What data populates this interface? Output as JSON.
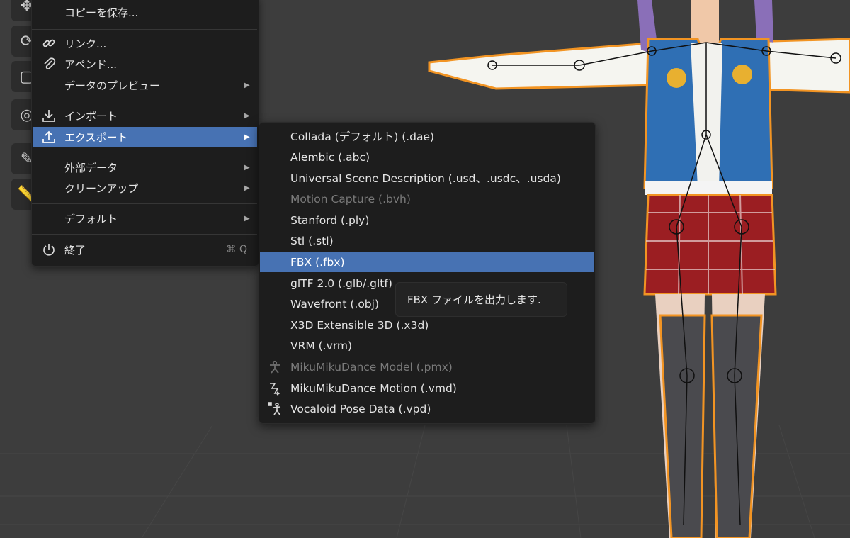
{
  "file_menu": {
    "items": [
      {
        "label": "コピーを保存...",
        "arrow": "",
        "shortcut": ""
      },
      {
        "label": "リンク...",
        "arrow": "",
        "shortcut": ""
      },
      {
        "label": "アペンド...",
        "arrow": "",
        "shortcut": ""
      },
      {
        "label": "データのプレビュー",
        "arrow": "▶",
        "shortcut": ""
      },
      {
        "label": "インポート",
        "arrow": "▶",
        "shortcut": ""
      },
      {
        "label": "エクスポート",
        "arrow": "▶",
        "shortcut": ""
      },
      {
        "label": "外部データ",
        "arrow": "▶",
        "shortcut": ""
      },
      {
        "label": "クリーンアップ",
        "arrow": "▶",
        "shortcut": ""
      },
      {
        "label": "デフォルト",
        "arrow": "▶",
        "shortcut": ""
      },
      {
        "label": "終了",
        "arrow": "",
        "shortcut": "⌘ Q"
      }
    ]
  },
  "export_menu": {
    "items": [
      {
        "label": "Collada (デフォルト) (.dae)",
        "enabled": true
      },
      {
        "label": "Alembic (.abc)",
        "enabled": true
      },
      {
        "label": "Universal Scene Description (.usd、.usdc、.usda)",
        "enabled": true
      },
      {
        "label": "Motion Capture (.bvh)",
        "enabled": false
      },
      {
        "label": "Stanford (.ply)",
        "enabled": true
      },
      {
        "label": "Stl (.stl)",
        "enabled": true
      },
      {
        "label": "FBX (.fbx)",
        "enabled": true
      },
      {
        "label": "glTF 2.0 (.glb/.gltf)",
        "enabled": true
      },
      {
        "label": "Wavefront (.obj)",
        "enabled": true
      },
      {
        "label": "X3D Extensible 3D (.x3d)",
        "enabled": true
      },
      {
        "label": "VRM (.vrm)",
        "enabled": true
      },
      {
        "label": "MikuMikuDance Model (.pmx)",
        "enabled": false
      },
      {
        "label": "MikuMikuDance Motion (.vmd)",
        "enabled": true
      },
      {
        "label": "Vocaloid Pose Data (.vpd)",
        "enabled": true
      }
    ]
  },
  "tooltip": {
    "text": "FBX ファイルを出力します."
  },
  "colors": {
    "highlight": "#4772b3",
    "menu_bg": "#1d1d1d",
    "viewport_bg": "#3d3d3d",
    "selection_outline": "#f29423"
  }
}
